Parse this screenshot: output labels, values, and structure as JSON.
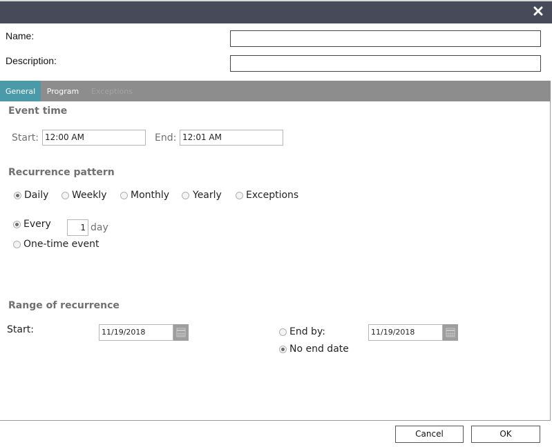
{
  "dialog": {
    "close_icon": "close-icon"
  },
  "name_field": {
    "label": "Name:",
    "value": ""
  },
  "description_field": {
    "label": "Description:",
    "value": ""
  },
  "tabs": [
    {
      "label": "General",
      "state": "active"
    },
    {
      "label": "Program",
      "state": "normal"
    },
    {
      "label": "Exceptions",
      "state": "disabled"
    }
  ],
  "event_time": {
    "heading": "Event time",
    "start_label": "Start:",
    "start_value": "12:00 AM",
    "end_label": "End:",
    "end_value": "12:01 AM"
  },
  "recurrence": {
    "heading": "Recurrence pattern",
    "options": [
      {
        "label": "Daily",
        "selected": true
      },
      {
        "label": "Weekly",
        "selected": false
      },
      {
        "label": "Monthly",
        "selected": false
      },
      {
        "label": "Yearly",
        "selected": false
      },
      {
        "label": "Exceptions",
        "selected": false
      }
    ],
    "every_label": "Every",
    "every_value": "1",
    "every_unit": "day",
    "every_selected": true,
    "one_time_label": "One-time event",
    "one_time_selected": false
  },
  "range": {
    "heading": "Range of recurrence",
    "start_label": "Start:",
    "start_date": "11/19/2018",
    "end_by_label": "End by:",
    "end_by_date": "11/19/2018",
    "end_by_selected": false,
    "no_end_label": "No end date",
    "no_end_selected": true
  },
  "footer": {
    "cancel_label": "Cancel",
    "ok_label": "OK"
  },
  "colors": {
    "titlebar": "#474a59",
    "tabbar": "#8d8d8d",
    "active_tab": "#4a9aaa",
    "section_heading": "#707070"
  }
}
